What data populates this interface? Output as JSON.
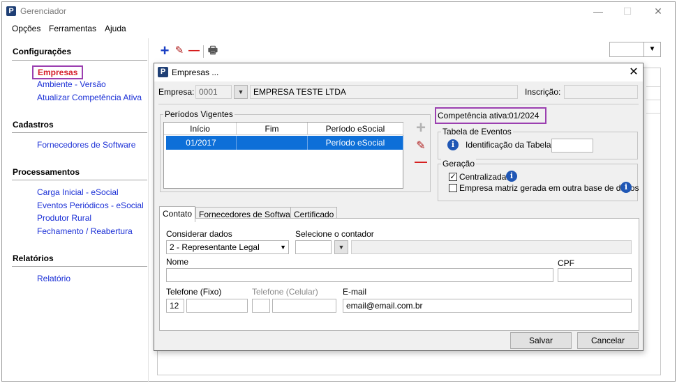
{
  "window": {
    "title": "Gerenciador",
    "logo_letter": "P",
    "minimize_glyph": "—",
    "maximize_glyph": "☐",
    "close_glyph": "✕"
  },
  "menu": [
    "Opções",
    "Ferramentas",
    "Ajuda"
  ],
  "sidebar": {
    "sections": [
      {
        "title": "Configurações",
        "items": [
          "Empresas",
          "Ambiente - Versão",
          "Atualizar Competência Ativa"
        ]
      },
      {
        "title": "Cadastros",
        "items": [
          "Fornecedores de Software"
        ]
      },
      {
        "title": "Processamentos",
        "items": [
          "Carga Inicial - eSocial",
          "Eventos Periódicos - eSocial",
          "Produtor Rural",
          "Fechamento / Reabertura"
        ]
      },
      {
        "title": "Relatórios",
        "items": [
          "Relatório"
        ]
      }
    ],
    "selected_item": "Empresas"
  },
  "toolbar": {
    "icons": [
      "add-icon",
      "edit-icon",
      "remove-icon",
      "print-icon"
    ],
    "glyphs": {
      "add": "+",
      "edit": "✎",
      "remove": "—",
      "print": "🖶"
    }
  },
  "dialog": {
    "title": "Empresas ...",
    "logo_letter": "P",
    "close_glyph": "✕",
    "empresa": {
      "label": "Empresa:",
      "code": "0001",
      "name": "EMPRESA TESTE LTDA"
    },
    "inscricao": {
      "label": "Inscrição:",
      "value": ""
    },
    "periodos": {
      "title": "Períodos Vigentes",
      "columns": [
        "Início",
        "Fim",
        "Período eSocial"
      ],
      "rows": [
        {
          "inicio": "01/2017",
          "fim": "",
          "periodo": "Período eSocial"
        }
      ]
    },
    "side_actions": {
      "add": "+",
      "edit": "✎",
      "remove": "—"
    },
    "competencia": {
      "label": "Competência ativa:",
      "value": "01/2024"
    },
    "tabela_eventos": {
      "title": "Tabela de Eventos",
      "label": "Identificação da Tabela",
      "value": ""
    },
    "geracao": {
      "title": "Geração",
      "centralizada": {
        "label": "Centralizada",
        "checked": true
      },
      "matriz": {
        "label": "Empresa matriz gerada em outra base de dados",
        "checked": false
      }
    },
    "tabs": [
      "Contato",
      "Fornecedores de Software",
      "Certificado"
    ],
    "active_tab": "Contato",
    "contato": {
      "considerar_label": "Considerar dados",
      "considerar_value": "2 - Representante Legal",
      "contador_label": "Selecione o contador",
      "contador_value": "",
      "nome_label": "Nome",
      "nome_value": "",
      "cpf_label": "CPF",
      "cpf_value": "",
      "tel_fixo_label": "Telefone (Fixo)",
      "tel_fixo_ddd": "12",
      "tel_fixo_numero": "",
      "tel_cel_label": "Telefone (Celular)",
      "tel_cel_ddd": "",
      "tel_cel_numero": "",
      "email_label": "E-mail",
      "email_value": "email@email.com.br"
    },
    "buttons": {
      "save": "Salvar",
      "cancel": "Cancelar"
    }
  },
  "colors": {
    "accent_blue": "#0d6fd8",
    "link_blue": "#1a2fd6",
    "highlight_purple": "#9b3fb0",
    "selected_red": "#d6202c"
  }
}
